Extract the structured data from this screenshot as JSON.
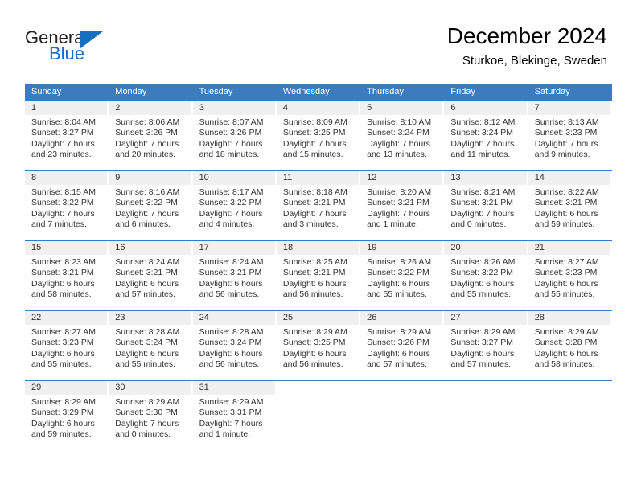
{
  "logo": {
    "word1": "General",
    "word2": "Blue"
  },
  "header": {
    "title": "December 2024",
    "subtitle": "Sturkoe, Blekinge, Sweden"
  },
  "weekdays": [
    "Sunday",
    "Monday",
    "Tuesday",
    "Wednesday",
    "Thursday",
    "Friday",
    "Saturday"
  ],
  "colors": {
    "header_blue": "#3a7cbe",
    "day_band_gray": "#f0f0f0",
    "logo_blue": "#176fc1",
    "text": "#333333"
  },
  "weeks": [
    [
      {
        "day": "1",
        "sunrise": "Sunrise: 8:04 AM",
        "sunset": "Sunset: 3:27 PM",
        "daylight1": "Daylight: 7 hours",
        "daylight2": "and 23 minutes."
      },
      {
        "day": "2",
        "sunrise": "Sunrise: 8:06 AM",
        "sunset": "Sunset: 3:26 PM",
        "daylight1": "Daylight: 7 hours",
        "daylight2": "and 20 minutes."
      },
      {
        "day": "3",
        "sunrise": "Sunrise: 8:07 AM",
        "sunset": "Sunset: 3:26 PM",
        "daylight1": "Daylight: 7 hours",
        "daylight2": "and 18 minutes."
      },
      {
        "day": "4",
        "sunrise": "Sunrise: 8:09 AM",
        "sunset": "Sunset: 3:25 PM",
        "daylight1": "Daylight: 7 hours",
        "daylight2": "and 15 minutes."
      },
      {
        "day": "5",
        "sunrise": "Sunrise: 8:10 AM",
        "sunset": "Sunset: 3:24 PM",
        "daylight1": "Daylight: 7 hours",
        "daylight2": "and 13 minutes."
      },
      {
        "day": "6",
        "sunrise": "Sunrise: 8:12 AM",
        "sunset": "Sunset: 3:24 PM",
        "daylight1": "Daylight: 7 hours",
        "daylight2": "and 11 minutes."
      },
      {
        "day": "7",
        "sunrise": "Sunrise: 8:13 AM",
        "sunset": "Sunset: 3:23 PM",
        "daylight1": "Daylight: 7 hours",
        "daylight2": "and 9 minutes."
      }
    ],
    [
      {
        "day": "8",
        "sunrise": "Sunrise: 8:15 AM",
        "sunset": "Sunset: 3:22 PM",
        "daylight1": "Daylight: 7 hours",
        "daylight2": "and 7 minutes."
      },
      {
        "day": "9",
        "sunrise": "Sunrise: 8:16 AM",
        "sunset": "Sunset: 3:22 PM",
        "daylight1": "Daylight: 7 hours",
        "daylight2": "and 6 minutes."
      },
      {
        "day": "10",
        "sunrise": "Sunrise: 8:17 AM",
        "sunset": "Sunset: 3:22 PM",
        "daylight1": "Daylight: 7 hours",
        "daylight2": "and 4 minutes."
      },
      {
        "day": "11",
        "sunrise": "Sunrise: 8:18 AM",
        "sunset": "Sunset: 3:21 PM",
        "daylight1": "Daylight: 7 hours",
        "daylight2": "and 3 minutes."
      },
      {
        "day": "12",
        "sunrise": "Sunrise: 8:20 AM",
        "sunset": "Sunset: 3:21 PM",
        "daylight1": "Daylight: 7 hours",
        "daylight2": "and 1 minute."
      },
      {
        "day": "13",
        "sunrise": "Sunrise: 8:21 AM",
        "sunset": "Sunset: 3:21 PM",
        "daylight1": "Daylight: 7 hours",
        "daylight2": "and 0 minutes."
      },
      {
        "day": "14",
        "sunrise": "Sunrise: 8:22 AM",
        "sunset": "Sunset: 3:21 PM",
        "daylight1": "Daylight: 6 hours",
        "daylight2": "and 59 minutes."
      }
    ],
    [
      {
        "day": "15",
        "sunrise": "Sunrise: 8:23 AM",
        "sunset": "Sunset: 3:21 PM",
        "daylight1": "Daylight: 6 hours",
        "daylight2": "and 58 minutes."
      },
      {
        "day": "16",
        "sunrise": "Sunrise: 8:24 AM",
        "sunset": "Sunset: 3:21 PM",
        "daylight1": "Daylight: 6 hours",
        "daylight2": "and 57 minutes."
      },
      {
        "day": "17",
        "sunrise": "Sunrise: 8:24 AM",
        "sunset": "Sunset: 3:21 PM",
        "daylight1": "Daylight: 6 hours",
        "daylight2": "and 56 minutes."
      },
      {
        "day": "18",
        "sunrise": "Sunrise: 8:25 AM",
        "sunset": "Sunset: 3:21 PM",
        "daylight1": "Daylight: 6 hours",
        "daylight2": "and 56 minutes."
      },
      {
        "day": "19",
        "sunrise": "Sunrise: 8:26 AM",
        "sunset": "Sunset: 3:22 PM",
        "daylight1": "Daylight: 6 hours",
        "daylight2": "and 55 minutes."
      },
      {
        "day": "20",
        "sunrise": "Sunrise: 8:26 AM",
        "sunset": "Sunset: 3:22 PM",
        "daylight1": "Daylight: 6 hours",
        "daylight2": "and 55 minutes."
      },
      {
        "day": "21",
        "sunrise": "Sunrise: 8:27 AM",
        "sunset": "Sunset: 3:23 PM",
        "daylight1": "Daylight: 6 hours",
        "daylight2": "and 55 minutes."
      }
    ],
    [
      {
        "day": "22",
        "sunrise": "Sunrise: 8:27 AM",
        "sunset": "Sunset: 3:23 PM",
        "daylight1": "Daylight: 6 hours",
        "daylight2": "and 55 minutes."
      },
      {
        "day": "23",
        "sunrise": "Sunrise: 8:28 AM",
        "sunset": "Sunset: 3:24 PM",
        "daylight1": "Daylight: 6 hours",
        "daylight2": "and 55 minutes."
      },
      {
        "day": "24",
        "sunrise": "Sunrise: 8:28 AM",
        "sunset": "Sunset: 3:24 PM",
        "daylight1": "Daylight: 6 hours",
        "daylight2": "and 56 minutes."
      },
      {
        "day": "25",
        "sunrise": "Sunrise: 8:29 AM",
        "sunset": "Sunset: 3:25 PM",
        "daylight1": "Daylight: 6 hours",
        "daylight2": "and 56 minutes."
      },
      {
        "day": "26",
        "sunrise": "Sunrise: 8:29 AM",
        "sunset": "Sunset: 3:26 PM",
        "daylight1": "Daylight: 6 hours",
        "daylight2": "and 57 minutes."
      },
      {
        "day": "27",
        "sunrise": "Sunrise: 8:29 AM",
        "sunset": "Sunset: 3:27 PM",
        "daylight1": "Daylight: 6 hours",
        "daylight2": "and 57 minutes."
      },
      {
        "day": "28",
        "sunrise": "Sunrise: 8:29 AM",
        "sunset": "Sunset: 3:28 PM",
        "daylight1": "Daylight: 6 hours",
        "daylight2": "and 58 minutes."
      }
    ],
    [
      {
        "day": "29",
        "sunrise": "Sunrise: 8:29 AM",
        "sunset": "Sunset: 3:29 PM",
        "daylight1": "Daylight: 6 hours",
        "daylight2": "and 59 minutes."
      },
      {
        "day": "30",
        "sunrise": "Sunrise: 8:29 AM",
        "sunset": "Sunset: 3:30 PM",
        "daylight1": "Daylight: 7 hours",
        "daylight2": "and 0 minutes."
      },
      {
        "day": "31",
        "sunrise": "Sunrise: 8:29 AM",
        "sunset": "Sunset: 3:31 PM",
        "daylight1": "Daylight: 7 hours",
        "daylight2": "and 1 minute."
      },
      {
        "day": "",
        "sunrise": "",
        "sunset": "",
        "daylight1": "",
        "daylight2": ""
      },
      {
        "day": "",
        "sunrise": "",
        "sunset": "",
        "daylight1": "",
        "daylight2": ""
      },
      {
        "day": "",
        "sunrise": "",
        "sunset": "",
        "daylight1": "",
        "daylight2": ""
      },
      {
        "day": "",
        "sunrise": "",
        "sunset": "",
        "daylight1": "",
        "daylight2": ""
      }
    ]
  ]
}
